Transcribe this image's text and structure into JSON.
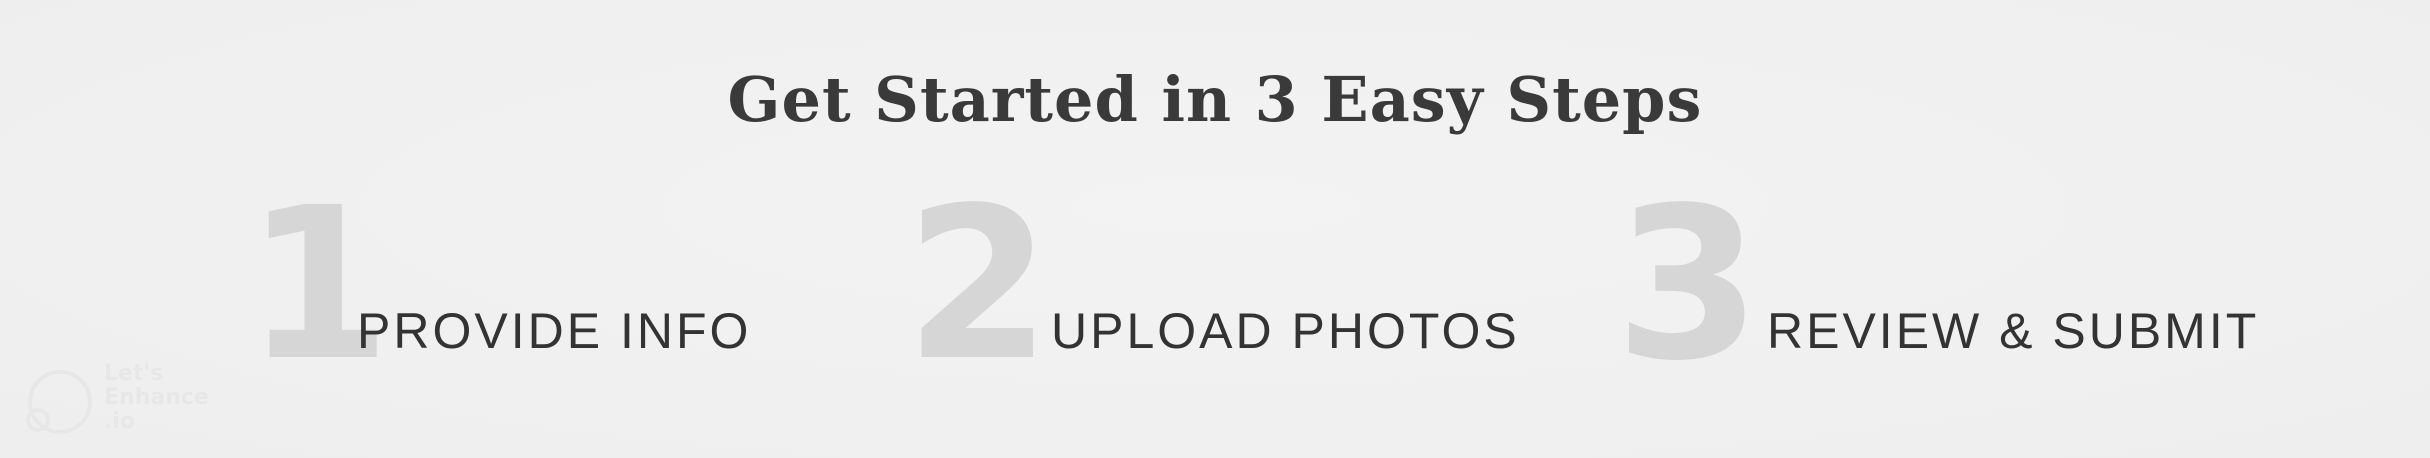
{
  "header": {
    "title": "Get Started in 3 Easy Steps"
  },
  "steps": [
    {
      "number": "1",
      "label": "PROVIDE INFO"
    },
    {
      "number": "2",
      "label": "UPLOAD PHOTOS"
    },
    {
      "number": "3",
      "label": "REVIEW & SUBMIT"
    }
  ],
  "watermark": {
    "text": "Let's\nEnhance\n.io",
    "color": "#e2e2e2"
  },
  "colors": {
    "background": "#f1f1f1",
    "title": "#3a3a3a",
    "step_number": "#d6d6d6",
    "step_label": "#333333"
  }
}
